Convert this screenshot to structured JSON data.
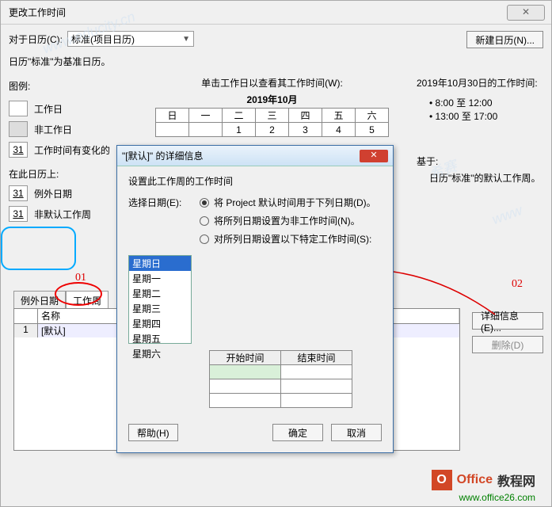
{
  "title": "更改工作时间",
  "for_calendar_label": "对于日历(C):",
  "calendar_combo": "标准(项目日历)",
  "new_calendar_btn": "新建日历(N)...",
  "base_cal_text": "日历\"标准\"为基准日历。",
  "legend_title": "图例:",
  "legend": {
    "work": "工作日",
    "nonwork": "非工作日",
    "edited": "工作时间有变化的",
    "num31": "31",
    "on_calendar": "在此日历上:",
    "exception": "例外日期",
    "nondefault": "非默认工作周"
  },
  "click_label": "单击工作日以查看其工作时间(W):",
  "cal_month": "2019年10月",
  "cal_headers": [
    "日",
    "一",
    "二",
    "三",
    "四",
    "五",
    "六"
  ],
  "cal_row1": [
    "",
    "",
    "1",
    "2",
    "3",
    "4",
    "5"
  ],
  "work_time_label": "2019年10月30日的工作时间:",
  "times": [
    "8:00 至 12:00",
    "13:00 至 17:00"
  ],
  "based_label": "基于:",
  "based_text": "日历\"标准\"的默认工作周。",
  "tabs": {
    "exceptions": "例外日期",
    "workweeks": "工作周"
  },
  "grid_header": "名称",
  "grid_row_num": "1",
  "grid_row_name": "[默认]",
  "details_btn": "详细信息(E)...",
  "delete_btn": "删除(D)",
  "annotations": {
    "a01": "01",
    "a02": "02"
  },
  "modal": {
    "title": "\"[默认]\" 的详细信息",
    "subtitle": "设置此工作周的工作时间",
    "select_label": "选择日期(E):",
    "radio1": "将 Project 默认时间用于下列日期(D)。",
    "radio2": "将所列日期设置为非工作时间(N)。",
    "radio3": "对所列日期设置以下特定工作时间(S):",
    "days": [
      "星期日",
      "星期一",
      "星期二",
      "星期三",
      "星期四",
      "星期五",
      "星期六"
    ],
    "time_headers": [
      "开始时间",
      "结束时间"
    ],
    "help_btn": "帮助(H)",
    "ok_btn": "确定",
    "cancel_btn": "取消"
  },
  "office_logo": {
    "letter": "O",
    "text1": "Office",
    "text2": "教程网",
    "url": "www.office26.com"
  }
}
